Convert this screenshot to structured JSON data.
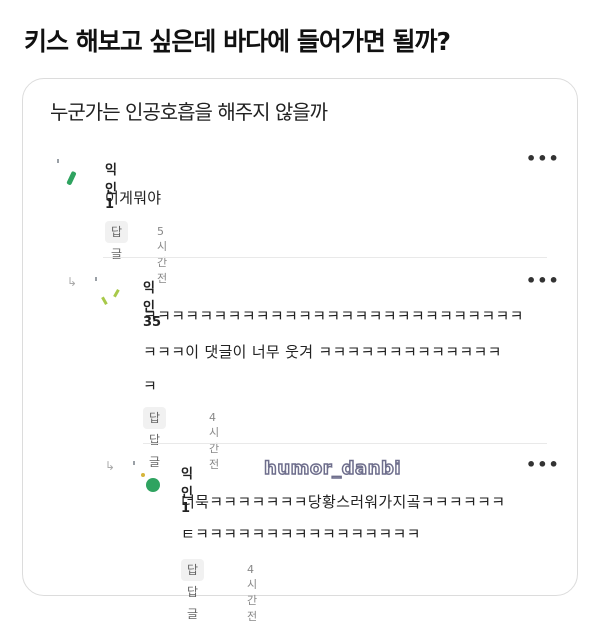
{
  "headline": "키스 해보고 싶은데 바다에 들어가면 될까?",
  "card": {
    "title": "누군가는 인공호흡을 해주지 않을까"
  },
  "comments": [
    {
      "nickname": "익인1",
      "lines": [
        "이게뭐야"
      ],
      "reply_label": "답글",
      "time": "5시간 전",
      "more": "•••"
    },
    {
      "nickname": "익인35",
      "lines": [
        "ㅋㅋㅋㅋㅋㅋㅋㅋㅋㅋㅋㅋㅋㅋㅋㅋㅋㅋㅋㅋㅋㅋㅋㅋㅋㅋㅋ",
        "ㅋㅋㅋ이 댓글이 너무 웃겨 ㅋㅋㅋㅋㅋㅋㅋㅋㅋㅋㅋㅋㅋ",
        "ㅋ"
      ],
      "reply_label": "답답글",
      "time": "4시간 전",
      "more": "•••"
    },
    {
      "nickname": "익인1",
      "lines": [
        "너묵ㅋㅋㅋㅋㅋㅋㅋ당황스러워가지곸ㅋㅋㅋㅋㅋㅋ",
        "ㅌㅋㅋㅋㅋㅋㅋㅋㅋㅋㅋㅋㅋㅋㅋㅋㅋ"
      ],
      "reply_label": "답답글",
      "time": "4시간 전",
      "more": "•••"
    }
  ],
  "reply_arrow": "↳",
  "watermark": "humor_danbi",
  "colors": {
    "avatar_green": "#2fa360",
    "avatar_lime": "#a8c94a",
    "border": "#dcdcdc"
  }
}
